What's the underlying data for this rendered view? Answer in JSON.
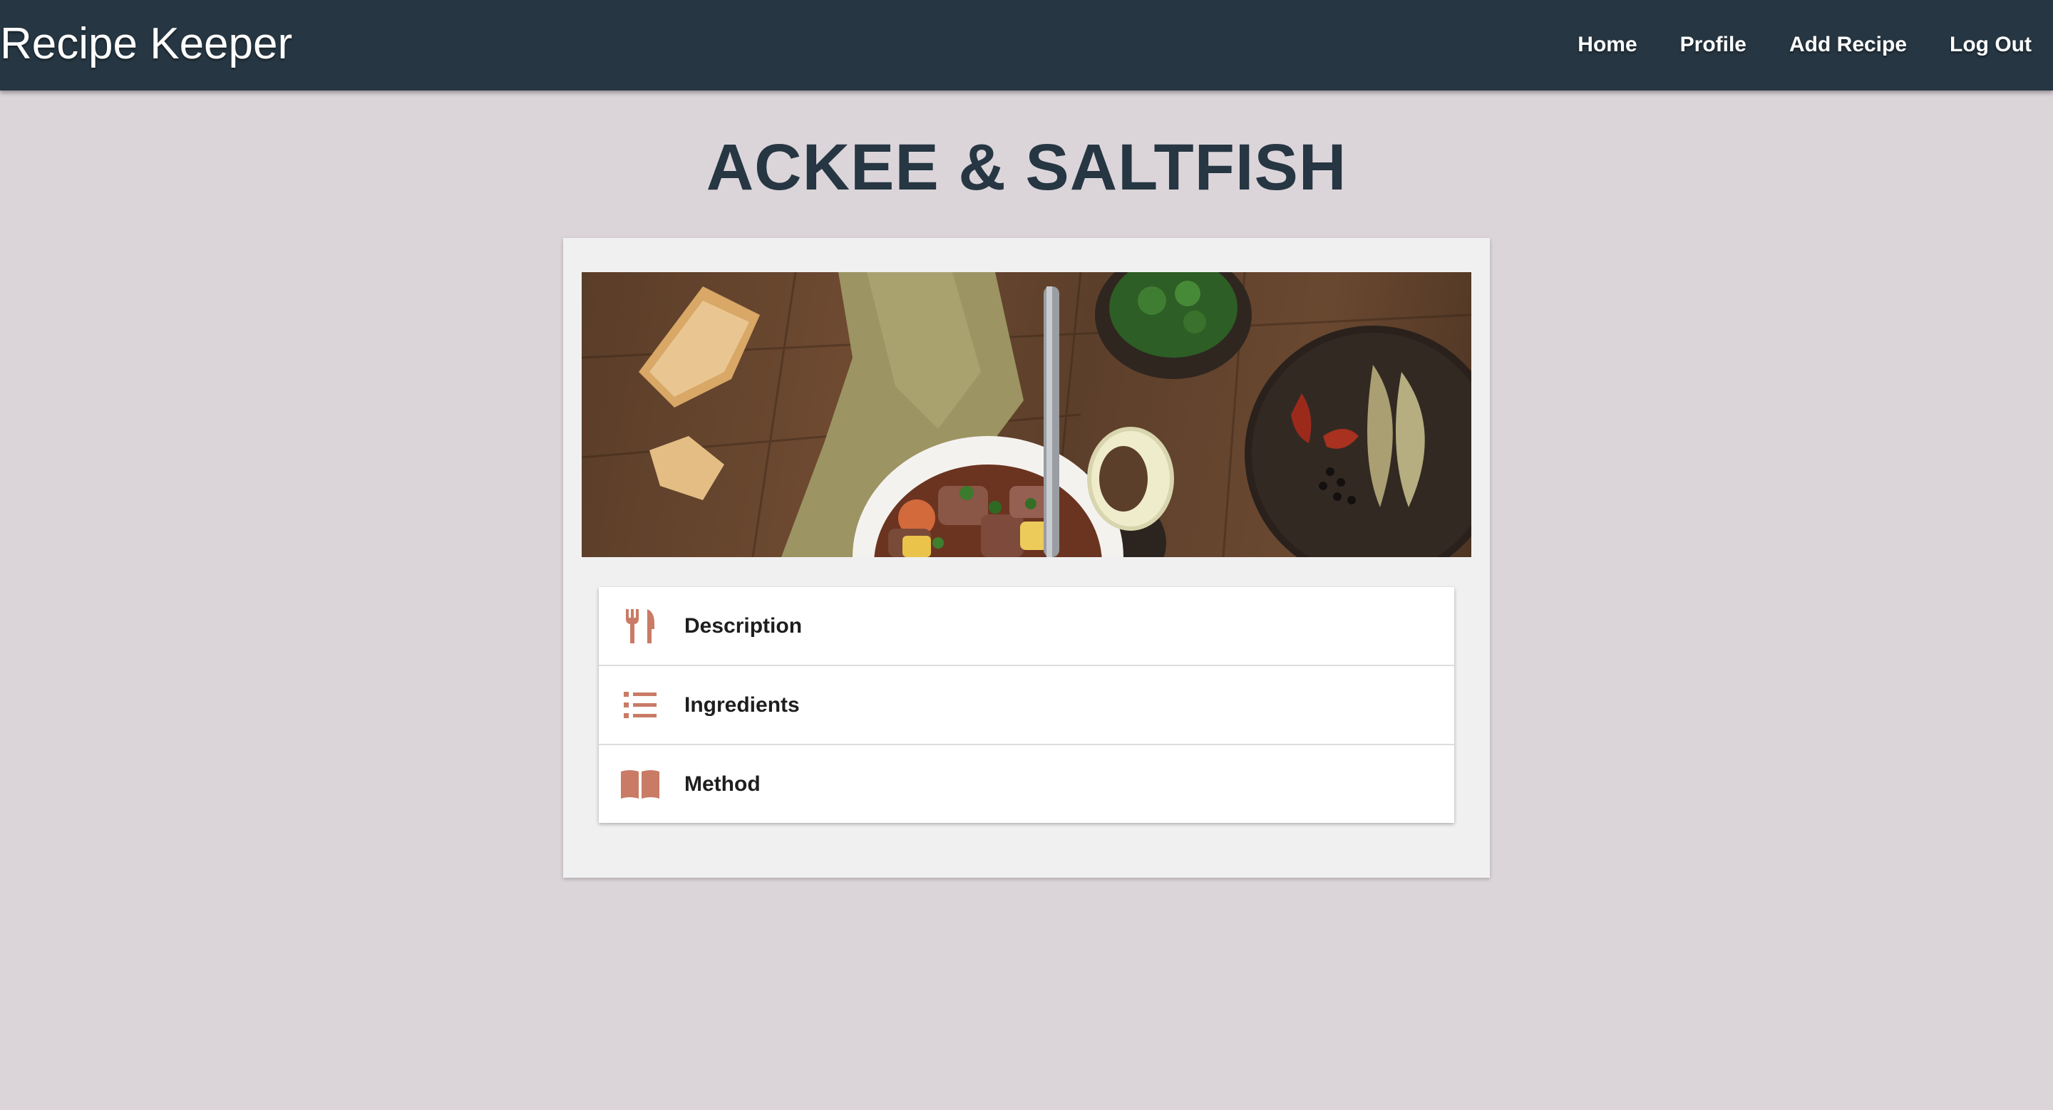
{
  "navbar": {
    "brand": "Recipe Keeper",
    "links": [
      {
        "label": "Home"
      },
      {
        "label": "Profile"
      },
      {
        "label": "Add Recipe"
      },
      {
        "label": "Log Out"
      }
    ]
  },
  "recipe": {
    "title": "ACKEE & SALTFISH",
    "image": "stew-bowl-on-wooden-table-photo",
    "sections": [
      {
        "label": "Description",
        "icon": "restaurant-icon"
      },
      {
        "label": "Ingredients",
        "icon": "list-icon"
      },
      {
        "label": "Method",
        "icon": "open-book-icon"
      }
    ]
  },
  "colors": {
    "navbar": "#263642",
    "background": "#dbd5da",
    "card": "#f0f0f1",
    "icon_accent": "#c97b66",
    "title": "#263642"
  }
}
